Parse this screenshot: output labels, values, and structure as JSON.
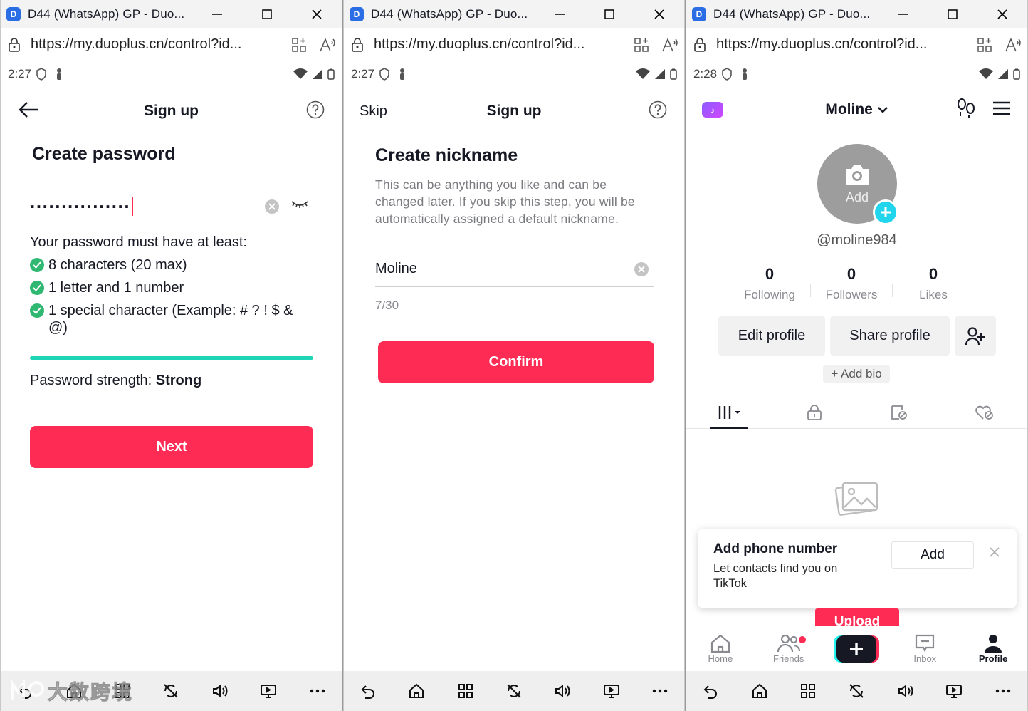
{
  "windows": [
    {
      "title": "D44  (WhatsApp)  GP - Duo...",
      "url": "https://my.duoplus.cn/control?id...",
      "status_time": "2:27",
      "header": {
        "title": "Sign up"
      },
      "heading": "Create password",
      "password_value": "................",
      "requirements_title": "Your password must have at least:",
      "requirements": [
        "8 characters (20 max)",
        "1 letter and 1 number",
        "1 special character (Example: # ? ! $ &",
        "@)"
      ],
      "strength_label": "Password strength: ",
      "strength_value": "Strong",
      "next_label": "Next",
      "watermark": "大数跨境"
    },
    {
      "title": "D44  (WhatsApp)  GP - Duo...",
      "url": "https://my.duoplus.cn/control?id...",
      "status_time": "2:27",
      "header": {
        "skip": "Skip",
        "title": "Sign up"
      },
      "heading": "Create nickname",
      "description": "This can be anything you like and can be changed later. If you skip this step, you will be automatically assigned a default nickname.",
      "nickname_value": "Moline",
      "counter": "7/30",
      "confirm_label": "Confirm"
    },
    {
      "title": "D44  (WhatsApp)  GP - Duo...",
      "url": "https://my.duoplus.cn/control?id...",
      "status_time": "2:28",
      "header": {
        "title": "Moline"
      },
      "avatar_text": "Add",
      "username": "@moline984",
      "stats": [
        {
          "num": "0",
          "label": "Following"
        },
        {
          "num": "0",
          "label": "Followers"
        },
        {
          "num": "0",
          "label": "Likes"
        }
      ],
      "edit_profile": "Edit profile",
      "share_profile": "Share profile",
      "add_bio": "+ Add bio",
      "popup": {
        "title": "Add phone number",
        "text": "Let contacts find you on TikTok",
        "add": "Add"
      },
      "upload_label": "Upload",
      "nav": [
        "Home",
        "Friends",
        "",
        "Inbox",
        "Profile"
      ]
    }
  ],
  "colors": {
    "brand_red": "#fe2c55",
    "success_green": "#2fb871",
    "strength_bar": "#20d5b5"
  }
}
